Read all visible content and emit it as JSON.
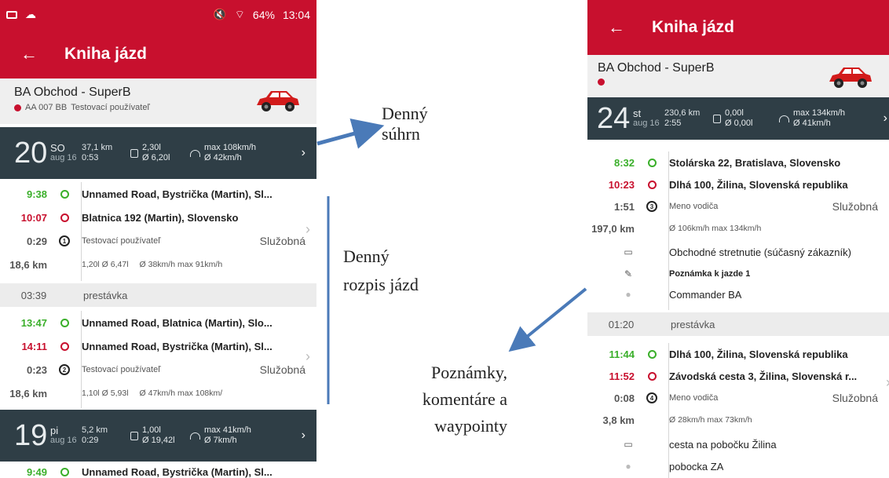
{
  "left": {
    "status": {
      "battery": "64%",
      "time": "13:04"
    },
    "appbar": {
      "back": "←",
      "title": "Kniha jázd"
    },
    "vehicle": {
      "name": "BA Obchod - SuperB",
      "plate": "AA 007 BB",
      "driver": "Testovací používateľ"
    },
    "day20": {
      "num": "20",
      "dow": "SO",
      "date": "aug 16",
      "km": "37,1 km",
      "time": "0:53",
      "fuel1": "2,30l",
      "fuel2": "Ø 6,20l",
      "speed1": "max 108km/h",
      "speed2": "Ø 42km/h"
    },
    "trip1": {
      "start": "9:38",
      "end": "10:07",
      "dur": "0:29",
      "dist": "18,6 km",
      "from": "Unnamed Road, Bystrička (Martin), Sl...",
      "to": "Blatnica 192 (Martin), Slovensko",
      "num": "1",
      "driver": "Testovací používateľ",
      "kind": "Služobná",
      "fuel": "1,20l  Ø 6,47l",
      "speed": "Ø 38km/h  max 91km/h"
    },
    "break1": {
      "time": "03:39",
      "label": "prestávka"
    },
    "trip2": {
      "start": "13:47",
      "end": "14:11",
      "dur": "0:23",
      "dist": "18,6 km",
      "from": "Unnamed Road, Blatnica (Martin), Slo...",
      "to": "Unnamed Road, Bystrička (Martin), Sl...",
      "num": "2",
      "driver": "Testovací používateľ",
      "kind": "Služobná",
      "fuel": "1,10l  Ø 5,93l",
      "speed": "Ø 47km/h  max 108km/"
    },
    "day19": {
      "num": "19",
      "dow": "pi",
      "date": "aug 16",
      "km": "5,2 km",
      "time": "0:29",
      "fuel1": "1,00l",
      "fuel2": "Ø 19,42l",
      "speed1": "max 41km/h",
      "speed2": "Ø 7km/h"
    },
    "trip3": {
      "start": "9:49",
      "from": "Unnamed Road, Bystrička (Martin), Sl..."
    }
  },
  "annotations": {
    "daily_summary": [
      "Denný",
      "súhrn"
    ],
    "daily_list": [
      "Denný",
      "rozpis jázd"
    ],
    "notes": [
      "Poznámky,",
      "komentáre a",
      "waypointy"
    ]
  },
  "right": {
    "appbar": {
      "back": "←",
      "title": "Kniha jázd"
    },
    "vehicle": {
      "name": "BA Obchod - SuperB"
    },
    "day24": {
      "num": "24",
      "dow": "st",
      "date": "aug 16",
      "km": "230,6 km",
      "time": "2:55",
      "fuel1": "0,00l",
      "fuel2": "Ø 0,00l",
      "speed1": "max 134km/h",
      "speed2": "Ø 41km/h"
    },
    "trip1": {
      "start": "8:32",
      "end": "10:23",
      "dur": "1:51",
      "dist": "197,0 km",
      "from": "Stolárska 22, Bratislava, Slovensko",
      "to": "Dlhá 100, Žilina, Slovenská republika",
      "num": "3",
      "driver": "Meno vodiča",
      "kind": "Služobná",
      "speed": "Ø 106km/h  max 134km/h",
      "comment": "Obchodné stretnutie (súčasný zákazník)",
      "note": "Poznámka k jazde 1",
      "waypoint": "Commander BA"
    },
    "break1": {
      "time": "01:20",
      "label": "prestávka"
    },
    "trip2": {
      "start": "11:44",
      "end": "11:52",
      "dur": "0:08",
      "dist": "3,8 km",
      "from": "Dlhá 100, Žilina, Slovenská republika",
      "to": "Závodská cesta 3, Žilina, Slovenská r...",
      "num": "4",
      "driver": "Meno vodiča",
      "kind": "Služobná",
      "speed": "Ø 28km/h  max 73km/h",
      "comment": "cesta na pobočku Žilina",
      "waypoint": "pobocka ZA"
    }
  },
  "colors": {
    "brand": "#c8102e",
    "header_dark": "#2f3e46",
    "green": "#3aaf2a"
  }
}
